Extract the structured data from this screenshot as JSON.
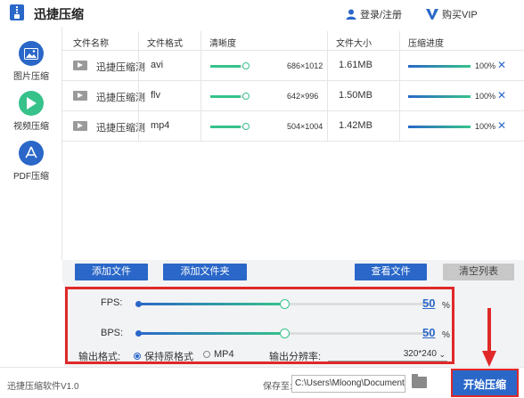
{
  "app": {
    "title": "迅捷压缩"
  },
  "header": {
    "login_label": "登录/注册",
    "vip_label": "购买VIP"
  },
  "sidebar": {
    "items": [
      {
        "label": "图片压缩",
        "icon": "image-icon"
      },
      {
        "label": "视频压缩",
        "icon": "play-icon"
      },
      {
        "label": "PDF压缩",
        "icon": "pdf-icon"
      }
    ]
  },
  "table": {
    "columns": [
      "文件名称",
      "文件格式",
      "清晰度",
      "文件大小",
      "压缩进度"
    ],
    "rows": [
      {
        "name": "迅捷压缩测",
        "format": "avi",
        "resolution": "686×1012",
        "size": "1.61MB",
        "progress_label": "100%",
        "clarity": 0.85,
        "progress": 1.0
      },
      {
        "name": "迅捷压缩测",
        "format": "flv",
        "resolution": "642×996",
        "size": "1.50MB",
        "progress_label": "100%",
        "clarity": 0.85,
        "progress": 1.0
      },
      {
        "name": "迅捷压缩测",
        "format": "mp4",
        "resolution": "504×1004",
        "size": "1.42MB",
        "progress_label": "100%",
        "clarity": 0.85,
        "progress": 1.0
      }
    ]
  },
  "actions": {
    "add_file": "添加文件",
    "add_folder": "添加文件夹",
    "view_file": "查看文件",
    "clear_list": "清空列表"
  },
  "settings": {
    "fps": {
      "label": "FPS:",
      "value": "50",
      "unit": "%",
      "fraction": 0.5
    },
    "bps": {
      "label": "BPS:",
      "value": "50",
      "unit": "%",
      "fraction": 0.5
    },
    "format_label": "输出格式:",
    "format_options": [
      {
        "label": "保持原格式",
        "selected": true
      },
      {
        "label": "MP4",
        "selected": false
      }
    ],
    "resolution_label": "输出分辨率:",
    "resolution_value": "320*240"
  },
  "footer": {
    "version": "迅捷压缩软件V1.0",
    "save_label": "保存至:",
    "save_path": "C:\\Users\\Mloong\\Documents",
    "start_button": "开始压缩"
  },
  "colors": {
    "accent": "#2a67c8",
    "highlight": "#e02828",
    "progress": "#36c28a"
  }
}
